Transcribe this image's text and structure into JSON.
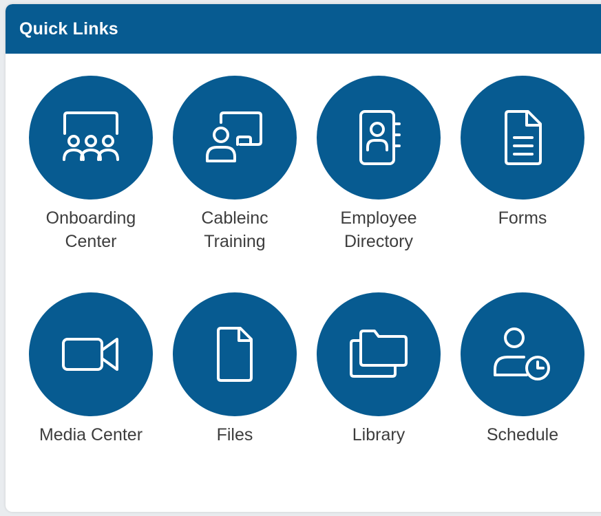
{
  "header": {
    "title": "Quick Links"
  },
  "colors": {
    "accent": "#075b91",
    "label": "#3d3d3d"
  },
  "links": [
    {
      "icon": "presentation-audience-icon",
      "label_lines": [
        "Onboarding",
        "Center"
      ]
    },
    {
      "icon": "presenter-board-icon",
      "label_lines": [
        "Cableinc",
        "Training"
      ]
    },
    {
      "icon": "contact-book-icon",
      "label_lines": [
        "Employee",
        "Directory"
      ]
    },
    {
      "icon": "document-icon",
      "label_lines": [
        "Forms"
      ]
    },
    {
      "icon": "video-camera-icon",
      "label_lines": [
        "Media Center"
      ]
    },
    {
      "icon": "file-icon",
      "label_lines": [
        "Files"
      ]
    },
    {
      "icon": "folders-icon",
      "label_lines": [
        "Library"
      ]
    },
    {
      "icon": "user-clock-icon",
      "label_lines": [
        "Schedule"
      ]
    }
  ]
}
